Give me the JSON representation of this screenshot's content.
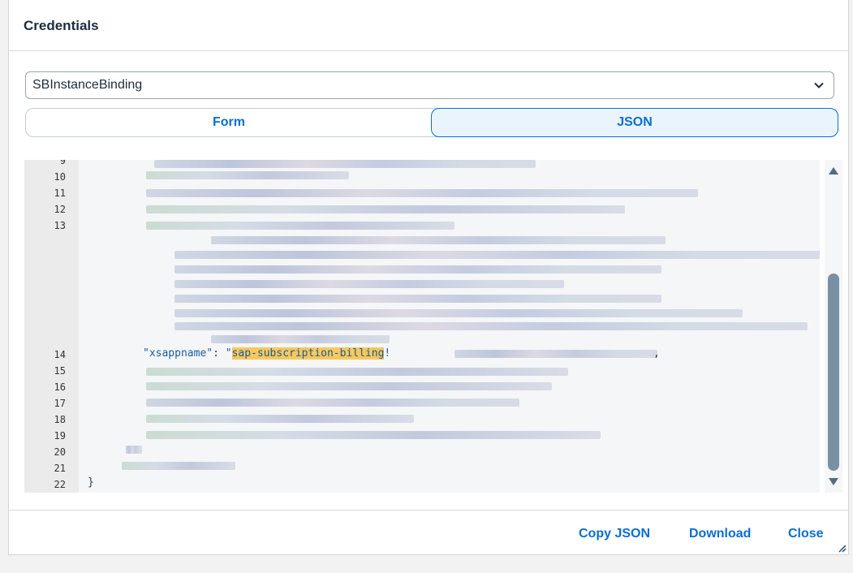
{
  "dialog": {
    "title": "Credentials"
  },
  "binding_select": {
    "value": "SBInstanceBinding",
    "icon": "chevron-down-icon"
  },
  "view_toggle": {
    "options": [
      "Form",
      "JSON"
    ],
    "selected": "JSON"
  },
  "editor": {
    "line_numbers": [
      "9",
      "10",
      "11",
      "12",
      "13",
      "14",
      "15",
      "16",
      "17",
      "18",
      "19",
      "20",
      "21",
      "22"
    ],
    "visible_line": {
      "key": "\"xsappname\"",
      "separator": ": ",
      "value_open_quote": "\"",
      "value_highlight": "sap-subscription-billing",
      "value_after": "!",
      "trailing": ","
    },
    "closing_brace": "}"
  },
  "footer": {
    "copy_label": "Copy JSON",
    "download_label": "Download",
    "close_label": "Close"
  },
  "colors": {
    "accent": "#0a6ed1",
    "highlight": "#f7c85c",
    "scroll_thumb": "#7990a4"
  }
}
